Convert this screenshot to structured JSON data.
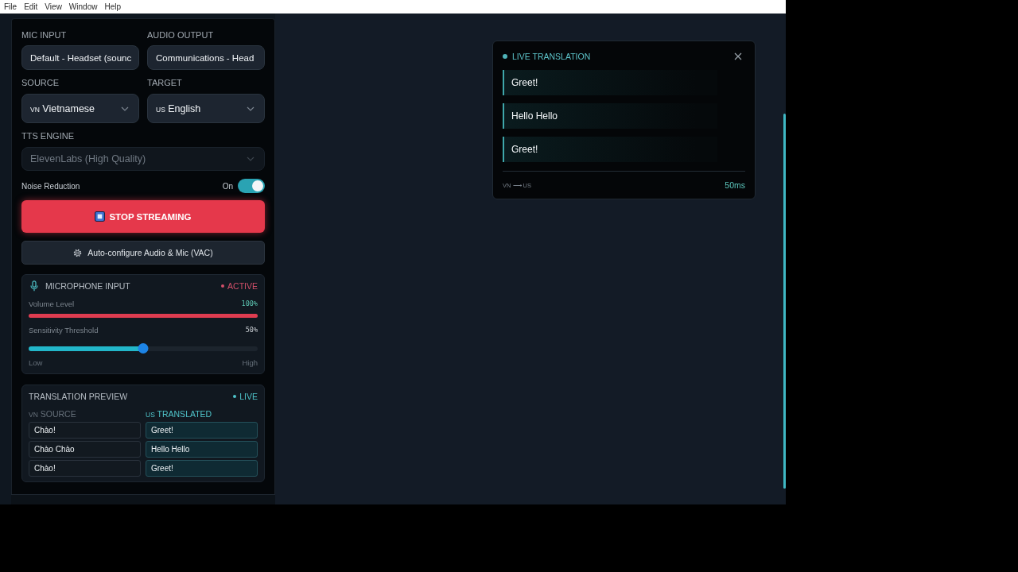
{
  "menu_bar": [
    "File",
    "Edit",
    "View",
    "Window",
    "Help"
  ],
  "settings": {
    "mic_input": {
      "label": "MIC INPUT",
      "value": "Default - Headset (sounc"
    },
    "audio_output": {
      "label": "AUDIO OUTPUT",
      "value": "Communications - Head"
    },
    "source": {
      "label": "SOURCE",
      "flag": "VN",
      "value": "Vietnamese"
    },
    "target": {
      "label": "TARGET",
      "flag": "US",
      "value": "English"
    },
    "tts_engine": {
      "label": "TTS ENGINE",
      "value": "ElevenLabs (High Quality)",
      "disabled": true
    },
    "noise_reduction": {
      "label": "Noise Reduction",
      "state_text": "On",
      "on": true
    }
  },
  "stop_button": {
    "label": "STOP STREAMING"
  },
  "auto_configure_button": {
    "label": "Auto-configure Audio & Mic (VAC)"
  },
  "microphone_input": {
    "title": "MICROPHONE INPUT",
    "status": "ACTIVE",
    "volume": {
      "label": "Volume Level",
      "reading": "100%",
      "level": 1.0
    },
    "sensitivity": {
      "label": "Sensitivity Threshold",
      "reading": "50%",
      "level": 0.5,
      "low_label": "Low",
      "high_label": "High"
    }
  },
  "translation_preview": {
    "title": "TRANSLATION PREVIEW",
    "status": "LIVE",
    "source_header": {
      "flag": "VN",
      "label": "SOURCE"
    },
    "translated_header": {
      "flag": "US",
      "label": "TRANSLATED"
    },
    "rows": [
      {
        "source": "Chào!",
        "translated": "Greet!"
      },
      {
        "source": "Chào Chào",
        "translated": "Hello Hello"
      },
      {
        "source": "Chào!",
        "translated": "Greet!"
      }
    ]
  },
  "live_translation": {
    "title": "LIVE TRANSLATION",
    "lines": [
      "Greet!",
      "Hello Hello",
      "Greet!"
    ],
    "route": "VN ⟶ US",
    "latency": "50ms"
  }
}
